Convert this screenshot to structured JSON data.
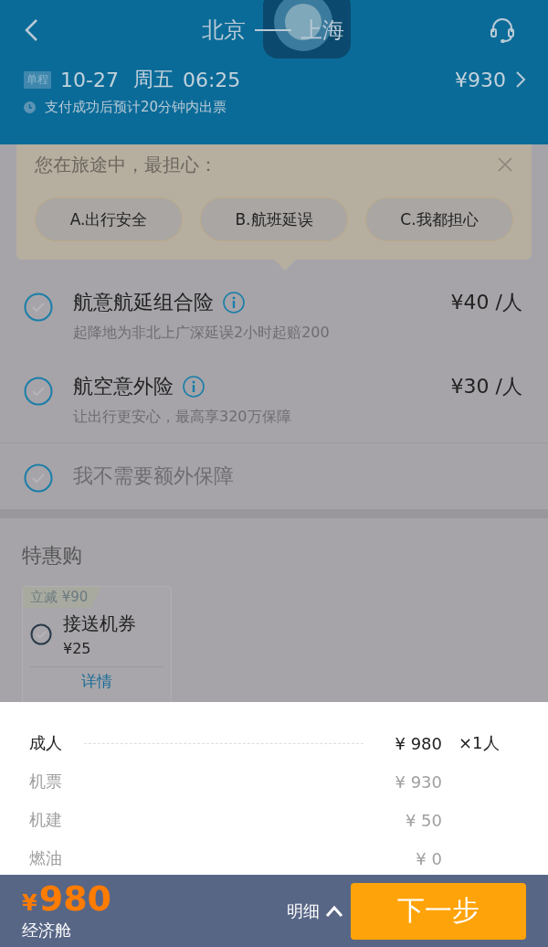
{
  "header": {
    "origin": "北京",
    "destination": "上海",
    "trip_badge": "单程",
    "date": "10-27",
    "weekday": "周五",
    "time": "06:25",
    "price": "¥930",
    "note": "支付成功后预计20分钟内出票"
  },
  "survey": {
    "question": "您在旅途中，最担心：",
    "options": [
      "A.出行安全",
      "B.航班延误",
      "C.我都担心"
    ]
  },
  "insurance": [
    {
      "name": "航意航延组合险",
      "desc": "起降地为非北上广深延误2小时起赔200",
      "price": "¥40 /人",
      "checked": false
    },
    {
      "name": "航空意外险",
      "desc": "让出行更安心，最高享320万保障",
      "price": "¥30 /人",
      "checked": false
    }
  ],
  "no_insurance": {
    "label": "我不需要额外保障",
    "checked": false
  },
  "deals": {
    "title": "特惠购",
    "items": [
      {
        "badge": "立减 ¥90",
        "name": "接送机券",
        "price": "¥25",
        "link": "详情",
        "checked": false
      }
    ]
  },
  "price_detail": {
    "rows": [
      {
        "kind": "total",
        "label": "成人",
        "amount": "¥ 980",
        "count": "×1人"
      },
      {
        "kind": "item",
        "label": "机票",
        "amount": "¥ 930"
      },
      {
        "kind": "item",
        "label": "机建",
        "amount": "¥ 50"
      },
      {
        "kind": "item",
        "label": "燃油",
        "amount": "¥ 0"
      }
    ]
  },
  "footer": {
    "currency": "¥",
    "total": "980",
    "cabin": "经济舱",
    "detail_toggle": {
      "label": "明细",
      "expanded": true
    },
    "next_button": "下一步"
  }
}
